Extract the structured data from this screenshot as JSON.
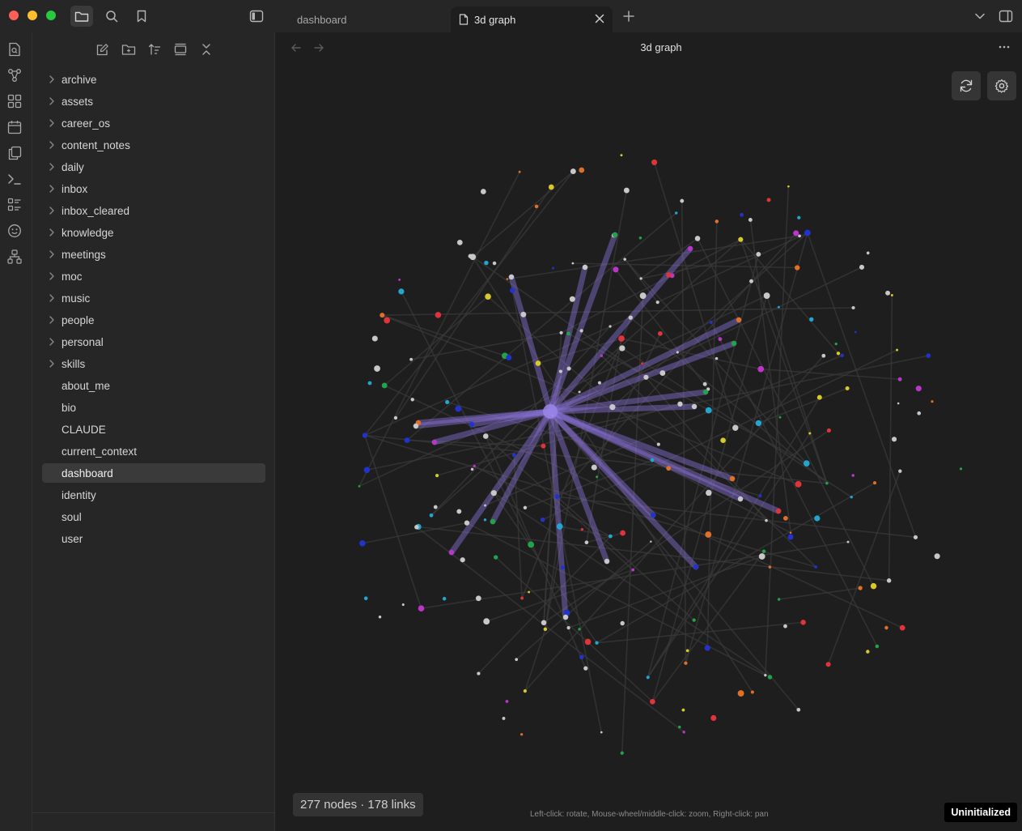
{
  "tabs": [
    {
      "label": "dashboard",
      "active": false
    },
    {
      "label": "3d graph",
      "active": true
    }
  ],
  "ribbon_icons": [
    "quick-switcher-icon",
    "graph-view-icon",
    "canvas-icon",
    "daily-note-icon",
    "templates-icon",
    "command-palette-icon",
    "bases-icon",
    "smiley-icon",
    "sitemap-icon"
  ],
  "sidebar": {
    "actions": [
      "new-note-icon",
      "new-folder-icon",
      "sort-icon",
      "collapse-view-icon",
      "collapse-all-icon"
    ],
    "items": [
      {
        "label": "archive",
        "folder": true
      },
      {
        "label": "assets",
        "folder": true
      },
      {
        "label": "career_os",
        "folder": true
      },
      {
        "label": "content_notes",
        "folder": true
      },
      {
        "label": "daily",
        "folder": true
      },
      {
        "label": "inbox",
        "folder": true
      },
      {
        "label": "inbox_cleared",
        "folder": true
      },
      {
        "label": "knowledge",
        "folder": true
      },
      {
        "label": "meetings",
        "folder": true
      },
      {
        "label": "moc",
        "folder": true
      },
      {
        "label": "music",
        "folder": true
      },
      {
        "label": "people",
        "folder": true
      },
      {
        "label": "personal",
        "folder": true
      },
      {
        "label": "skills",
        "folder": true
      },
      {
        "label": "about_me",
        "folder": false
      },
      {
        "label": "bio",
        "folder": false
      },
      {
        "label": "CLAUDE",
        "folder": false
      },
      {
        "label": "current_context",
        "folder": false
      },
      {
        "label": "dashboard",
        "folder": false,
        "selected": true
      },
      {
        "label": "identity",
        "folder": false
      },
      {
        "label": "soul",
        "folder": false
      },
      {
        "label": "user",
        "folder": false
      }
    ]
  },
  "view": {
    "title": "3d graph",
    "stats": "277 nodes · 178 links",
    "hint": "Left-click: rotate, Mouse-wheel/middle-click: zoom, Right-click: pan",
    "status_badge": "Uninitialized"
  },
  "colors": {
    "accent_purple": "#8a72d8",
    "node_default": "#c8c8c8"
  }
}
